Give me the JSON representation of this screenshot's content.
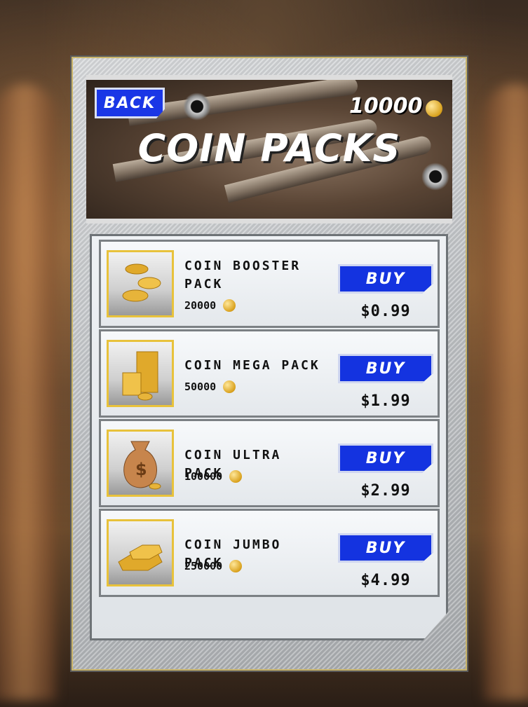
{
  "header": {
    "back_label": "BACK",
    "balance": "10000",
    "title": "COIN PACKS"
  },
  "packs": [
    {
      "name": "COIN BOOSTER PACK",
      "amount": "20000",
      "buy_label": "BUY",
      "price": "$0.99",
      "icon": "coins-scattered-icon"
    },
    {
      "name": "COIN MEGA PACK",
      "amount": "50000",
      "buy_label": "BUY",
      "price": "$1.99",
      "icon": "coin-stacks-icon"
    },
    {
      "name": "COIN ULTRA PACK",
      "amount": "100000",
      "buy_label": "BUY",
      "price": "$2.99",
      "icon": "money-bag-icon"
    },
    {
      "name": "COIN JUMBO PACK",
      "amount": "250000",
      "buy_label": "BUY",
      "price": "$4.99",
      "icon": "gold-bars-icon"
    }
  ],
  "colors": {
    "button_blue": "#1433e0",
    "thumb_border": "#e8c23b",
    "coin_gold": "#d9a11d"
  }
}
